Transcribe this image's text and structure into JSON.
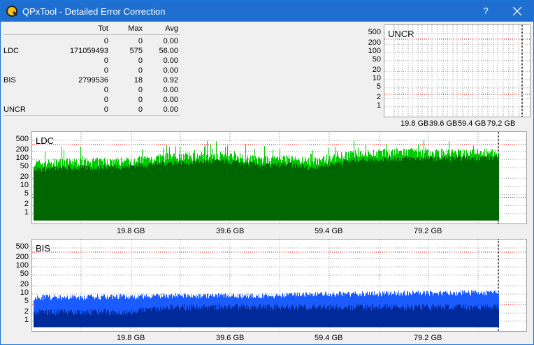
{
  "window": {
    "title": "QPxTool - Detailed Error Correction",
    "help_label": "?",
    "accent": "#1e6fd0"
  },
  "stats": {
    "headers": {
      "tot": "Tot",
      "max": "Max",
      "avg": "Avg"
    },
    "rows": [
      {
        "label": "",
        "tot": "0",
        "max": "0",
        "avg": "0.00"
      },
      {
        "label": "LDC",
        "tot": "171059493",
        "max": "575",
        "avg": "56.00"
      },
      {
        "label": "",
        "tot": "0",
        "max": "0",
        "avg": "0.00"
      },
      {
        "label": "",
        "tot": "0",
        "max": "0",
        "avg": "0.00"
      },
      {
        "label": "BIS",
        "tot": "2799536",
        "max": "18",
        "avg": "0.92"
      },
      {
        "label": "",
        "tot": "0",
        "max": "0",
        "avg": "0.00"
      },
      {
        "label": "",
        "tot": "0",
        "max": "0",
        "avg": "0.00"
      },
      {
        "label": "UNCR",
        "tot": "0",
        "max": "0",
        "avg": "0.00"
      }
    ]
  },
  "charts": {
    "uncr": {
      "title": "UNCR"
    },
    "ldc": {
      "title": "LDC"
    },
    "bis": {
      "title": "BIS"
    }
  },
  "chart_data": [
    {
      "type": "area",
      "title": "UNCR",
      "y_scale": "log",
      "y_ticks": [
        "500",
        "200",
        "100",
        "50",
        "20",
        "10",
        "5",
        "2",
        "1"
      ],
      "x_ticks": [
        "19.8 GB",
        "39.6 GB",
        "59.4 GB",
        "79.2 GB"
      ],
      "series": [
        {
          "values": [
            0,
            0,
            0,
            0,
            0,
            0,
            0,
            0,
            0,
            0
          ]
        }
      ],
      "colors": {
        "grid": "#808080",
        "threshold": "#cc0000"
      }
    },
    {
      "type": "area",
      "title": "LDC",
      "y_scale": "log",
      "y_ticks": [
        "500",
        "200",
        "100",
        "50",
        "20",
        "10",
        "5",
        "2",
        "1"
      ],
      "x_ticks": [
        "19.8 GB",
        "39.6 GB",
        "59.4 GB",
        "79.2 GB"
      ],
      "x": [
        0,
        10,
        20,
        30,
        40,
        50,
        55,
        60,
        70,
        80,
        90,
        100
      ],
      "series": [
        {
          "values": [
            60,
            70,
            75,
            110,
            120,
            80,
            90,
            70,
            140,
            160,
            150,
            160
          ],
          "color": "#00cc00"
        },
        {
          "values": [
            40,
            45,
            50,
            70,
            80,
            55,
            60,
            45,
            90,
            100,
            100,
            110
          ],
          "color": "#006600"
        }
      ],
      "colors": {
        "grid": "#808080",
        "threshold": "#cc0000"
      }
    },
    {
      "type": "area",
      "title": "BIS",
      "y_scale": "log",
      "y_ticks": [
        "500",
        "200",
        "100",
        "50",
        "20",
        "10",
        "5",
        "2",
        "1"
      ],
      "x_ticks": [
        "19.8 GB",
        "39.6 GB",
        "59.4 GB",
        "79.2 GB"
      ],
      "x": [
        0,
        10,
        20,
        30,
        40,
        50,
        55,
        60,
        70,
        80,
        90,
        100
      ],
      "series": [
        {
          "values": [
            7,
            7,
            7.5,
            8,
            8,
            8,
            8.5,
            9,
            9.5,
            10,
            10,
            10.5
          ],
          "color": "#1a5cff"
        },
        {
          "values": [
            2,
            2,
            2,
            3,
            3,
            3,
            3,
            3,
            3,
            3,
            3,
            3
          ],
          "color": "#002a99"
        }
      ],
      "colors": {
        "grid": "#808080",
        "threshold": "#cc0000"
      }
    }
  ]
}
